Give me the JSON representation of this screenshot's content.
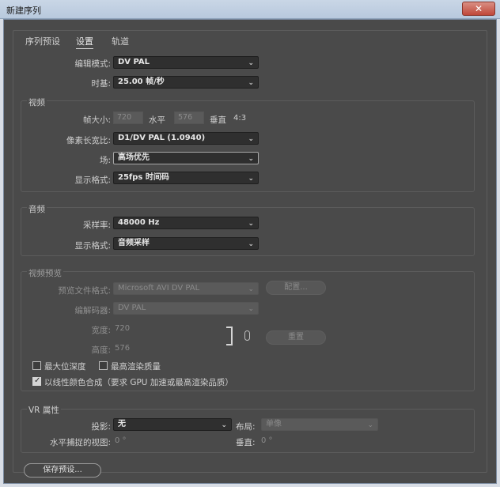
{
  "window": {
    "title": "新建序列",
    "close_glyph": "✕"
  },
  "tabs": [
    {
      "label": "序列预设",
      "active": false
    },
    {
      "label": "设置",
      "active": true
    },
    {
      "label": "轨道",
      "active": false
    }
  ],
  "general": {
    "edit_mode_label": "编辑模式:",
    "edit_mode_value": "DV PAL",
    "timebase_label": "时基:",
    "timebase_value": "25.00  帧/秒"
  },
  "video": {
    "title": "视频",
    "frame_size_label": "帧大小:",
    "frame_width": "720",
    "horizontal_label": "水平",
    "frame_height": "576",
    "vertical_label": "垂直",
    "aspect": "4:3",
    "pixel_aspect_label": "像素长宽比:",
    "pixel_aspect_value": "D1/DV PAL (1.0940)",
    "fields_label": "场:",
    "fields_value": "高场优先",
    "display_format_label": "显示格式:",
    "display_format_value": "25fps 时间码"
  },
  "audio": {
    "title": "音频",
    "sample_rate_label": "采样率:",
    "sample_rate_value": "48000 Hz",
    "display_format_label": "显示格式:",
    "display_format_value": "音频采样"
  },
  "video_preview": {
    "title": "视频预览",
    "file_format_label": "预览文件格式:",
    "file_format_value": "Microsoft AVI DV PAL",
    "config_button": "配置...",
    "codec_label": "编解码器:",
    "codec_value": "DV PAL",
    "width_label": "宽度:",
    "width_value": "720",
    "height_label": "高度:",
    "height_value": "576",
    "reset_button": "重置"
  },
  "options": {
    "max_bit_depth": {
      "label": "最大位深度",
      "checked": false
    },
    "max_render_quality": {
      "label": "最高渲染质量",
      "checked": false
    },
    "linear_color": {
      "label": "以线性颜色合成（要求 GPU 加速或最高渲染品质）",
      "checked": true
    }
  },
  "vr": {
    "title": "VR 属性",
    "projection_label": "投影:",
    "projection_value": "无",
    "layout_label": "布局:",
    "layout_value": "单像",
    "h_view_label": "水平捕捉的视图:",
    "h_view_value": "0 °",
    "vertical_label": "垂直:",
    "vertical_value": "0 °"
  },
  "footer": {
    "save_preset_button": "保存预设..."
  },
  "icons": {
    "chevron": "⌄",
    "checkmark": "✓"
  }
}
